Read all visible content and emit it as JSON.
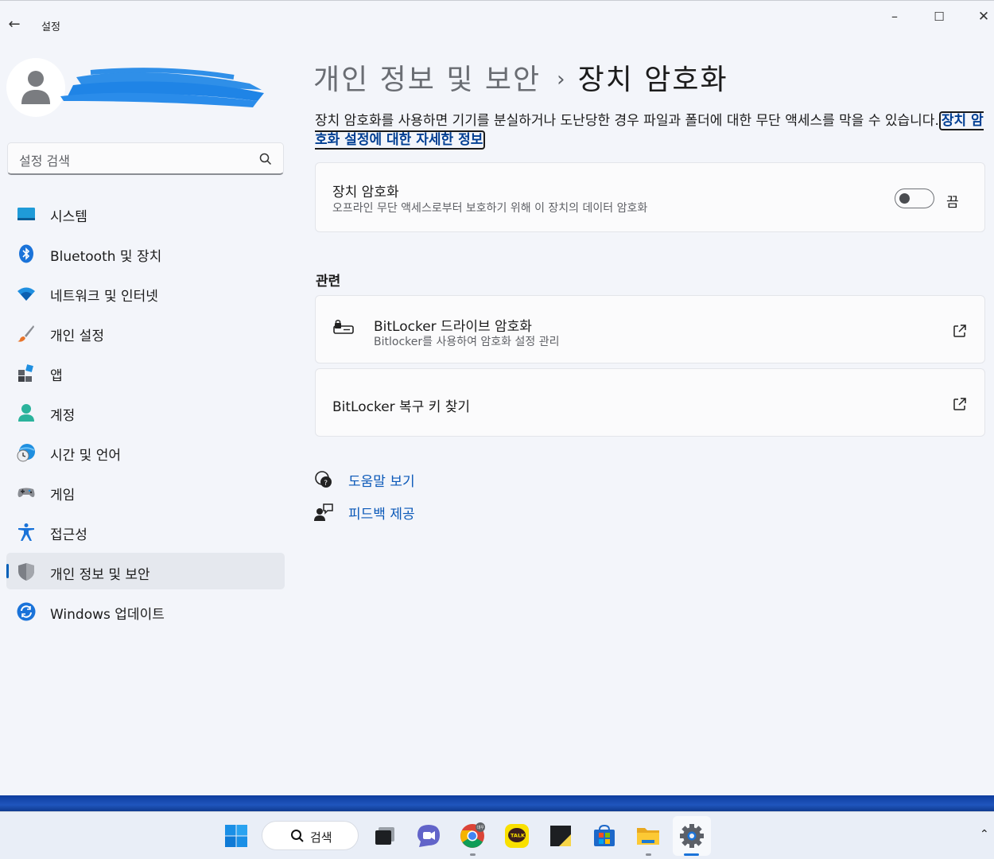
{
  "window": {
    "app_title": "설정",
    "controls": {
      "minimize": "–",
      "maximize": "☐",
      "close": "✕"
    }
  },
  "search": {
    "placeholder": "설정 검색"
  },
  "nav": {
    "items": [
      {
        "label": "시스템",
        "icon": "system-icon"
      },
      {
        "label": "Bluetooth 및 장치",
        "icon": "bluetooth-icon"
      },
      {
        "label": "네트워크 및 인터넷",
        "icon": "wifi-icon"
      },
      {
        "label": "개인 설정",
        "icon": "brush-icon"
      },
      {
        "label": "앱",
        "icon": "apps-icon"
      },
      {
        "label": "계정",
        "icon": "account-icon"
      },
      {
        "label": "시간 및 언어",
        "icon": "time-language-icon"
      },
      {
        "label": "게임",
        "icon": "gamepad-icon"
      },
      {
        "label": "접근성",
        "icon": "accessibility-icon"
      },
      {
        "label": "개인 정보 및 보안",
        "icon": "shield-icon",
        "active": true
      },
      {
        "label": "Windows 업데이트",
        "icon": "update-icon"
      }
    ]
  },
  "main": {
    "breadcrumb": {
      "parent": "개인 정보 및 보안",
      "separator": "›",
      "current": "장치 암호화"
    },
    "description": "장치 암호화를 사용하면 기기를 분실하거나 도난당한 경우 파일과 폴더에 대한 무단 액세스를 막을 수 있습니다.",
    "description_link": "장치 암호화 설정에 대한 자세한 정보",
    "encryption_card": {
      "title": "장치 암호화",
      "subtitle": "오프라인 무단 액세스로부터 보호하기 위해 이 장치의 데이터 암호화",
      "toggle_state": "끔",
      "toggle_on": false
    },
    "related": {
      "heading": "관련",
      "items": [
        {
          "title": "BitLocker 드라이브 암호화",
          "subtitle": "Bitlocker를 사용하여 암호화 설정 관리"
        },
        {
          "title": "BitLocker 복구 키 찾기"
        }
      ]
    },
    "help": {
      "get_help": "도움말 보기",
      "feedback": "피드백 제공"
    }
  },
  "taskbar": {
    "search_label": "검색",
    "apps": [
      "windows-start-icon",
      "task-view-icon",
      "teams-chat-icon",
      "chrome-icon",
      "kakaotalk-icon",
      "sticky-notes-icon",
      "store-icon",
      "file-explorer-icon",
      "settings-icon"
    ],
    "chrome_badge": "대우",
    "kakao_label": "TALK"
  },
  "colors": {
    "accent": "#005fb8",
    "link": "#0a58b8",
    "window_bg": "#f3f5fa",
    "card_bg": "#fbfbfc"
  }
}
